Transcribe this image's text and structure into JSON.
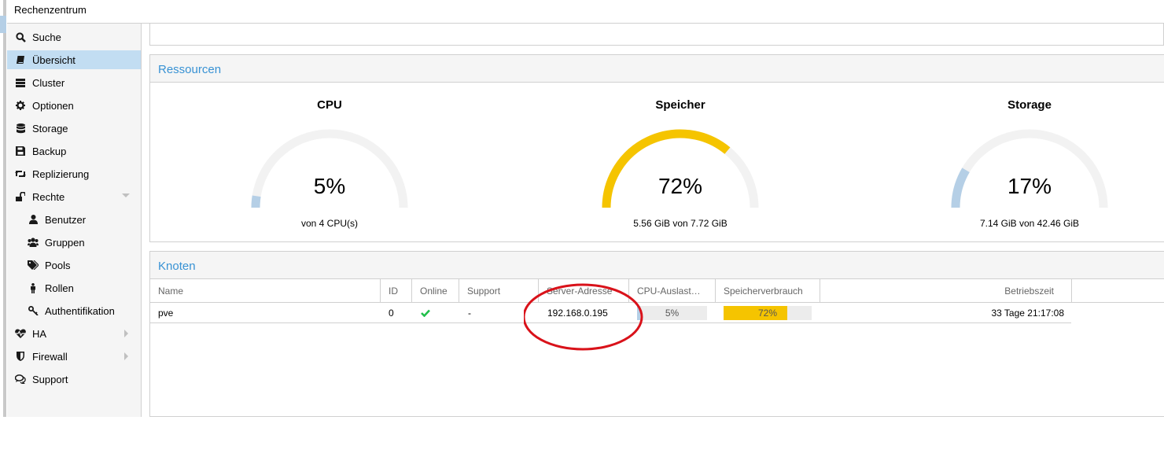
{
  "window": {
    "title": "Rechenzentrum"
  },
  "sidebar": {
    "items": [
      {
        "label": "Suche",
        "icon": "search-icon"
      },
      {
        "label": "Übersicht",
        "icon": "book-icon",
        "selected": true
      },
      {
        "label": "Cluster",
        "icon": "server-icon"
      },
      {
        "label": "Optionen",
        "icon": "gear-icon"
      },
      {
        "label": "Storage",
        "icon": "database-icon"
      },
      {
        "label": "Backup",
        "icon": "floppy-icon"
      },
      {
        "label": "Replizierung",
        "icon": "retweet-icon"
      },
      {
        "label": "Rechte",
        "icon": "unlock-icon",
        "expanded": true
      },
      {
        "label": "Benutzer",
        "icon": "user-icon"
      },
      {
        "label": "Gruppen",
        "icon": "users-icon"
      },
      {
        "label": "Pools",
        "icon": "tags-icon"
      },
      {
        "label": "Rollen",
        "icon": "male-icon"
      },
      {
        "label": "Authentifikation",
        "icon": "key-icon"
      },
      {
        "label": "HA",
        "icon": "heartbeat-icon"
      },
      {
        "label": "Firewall",
        "icon": "shield-icon"
      },
      {
        "label": "Support",
        "icon": "comments-icon"
      }
    ]
  },
  "resources": {
    "title": "Ressourcen",
    "gauges": [
      {
        "title": "CPU",
        "value": "5%",
        "fraction": 0.05,
        "sub": "von 4 CPU(s)",
        "color": "#b5cfe6"
      },
      {
        "title": "Speicher",
        "value": "72%",
        "fraction": 0.72,
        "sub": "5.56 GiB von 7.72 GiB",
        "color": "#f5c400"
      },
      {
        "title": "Storage",
        "value": "17%",
        "fraction": 0.17,
        "sub": "7.14 GiB von 42.46 GiB",
        "color": "#b5cfe6"
      }
    ]
  },
  "nodes": {
    "title": "Knoten",
    "columns": [
      "Name",
      "ID",
      "Online",
      "Support",
      "Server-Adresse",
      "CPU-Auslast…",
      "Speicherverbrauch",
      "Betriebszeit"
    ],
    "rows": [
      {
        "name": "pve",
        "id": "0",
        "online_icon": "check-icon",
        "support": "-",
        "address": "192.168.0.195",
        "cpu": "5%",
        "cpu_fraction": 0.05,
        "mem": "72%",
        "mem_fraction": 0.72,
        "uptime": "33 Tage 21:17:08"
      }
    ]
  },
  "colors": {
    "accent": "#3892d4",
    "selection": "#c2ddf2",
    "memory_bar": "#f5c400",
    "cpu_bar": "#b5cfe6",
    "online_check": "#21bf4b",
    "annotation": "#d9121a"
  }
}
